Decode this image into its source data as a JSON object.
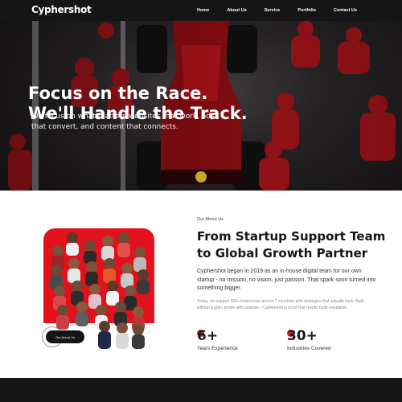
{
  "nav": {
    "logo": "Cyphershot",
    "links": [
      "Home",
      "About Us",
      "Service",
      "Portfolio",
      "Contact Us"
    ]
  },
  "hero": {
    "title_line1": "Focus on the Race.",
    "title_line2": "We'll Handle the Track.",
    "subtitle": "We focus on what matters websites that work, ads that convert, and content that connects."
  },
  "about": {
    "eyebrow": "Our About Us",
    "title": "From Startup Support Team to Global Growth Partner",
    "paragraph1": "Cyphershot began in 2019 as an in-house digital team for our own startup - no mission, no vision, just passion. That spark soon turned into something bigger.",
    "paragraph2": "Today, we support 300+ businesses across 7 countries with strategies that actually work. Built without a plan, grown with purpose - Cyphershot is proof that results build reputation.",
    "button_label": "Our About Us",
    "stats": [
      {
        "value": "6+",
        "label": "Years Experience"
      },
      {
        "value": "30+",
        "label": "Industries Covered"
      }
    ]
  },
  "colors": {
    "accent": "#d81d22",
    "nav_bg": "#151515"
  }
}
